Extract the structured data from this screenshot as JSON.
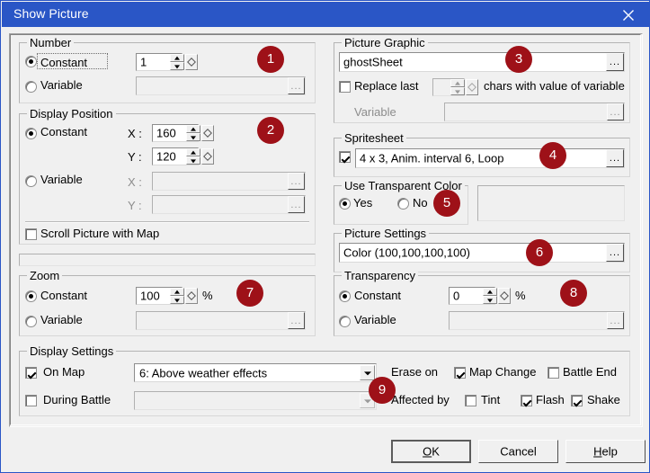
{
  "window": {
    "title": "Show Picture",
    "close_icon": "close-icon",
    "titlebar_color": "#2a56c6",
    "badge_color": "#9e1118",
    "background_color": "#f0f0f0"
  },
  "number_group": {
    "legend": "Number",
    "constant_label": "Constant",
    "constant_selected": true,
    "constant_value": "1",
    "variable_label": "Variable",
    "variable_selected": false,
    "variable_value": "",
    "browse_label": "...",
    "badge": "1"
  },
  "display_position_group": {
    "legend": "Display Position",
    "constant_label": "Constant",
    "constant_selected": true,
    "x_label": "X :",
    "x_value": "160",
    "y_label": "Y :",
    "y_value": "120",
    "variable_label": "Variable",
    "variable_selected": false,
    "var_x_label": "X :",
    "var_x_value": "",
    "var_y_label": "Y :",
    "var_y_value": "",
    "scroll_label": "Scroll Picture with Map",
    "scroll_checked": false,
    "browse_label": "...",
    "badge": "2"
  },
  "zoom_group": {
    "legend": "Zoom",
    "constant_label": "Constant",
    "constant_selected": true,
    "constant_value": "100",
    "percent": "%",
    "variable_label": "Variable",
    "variable_selected": false,
    "variable_value": "",
    "browse_label": "...",
    "badge": "7"
  },
  "picture_graphic_group": {
    "legend": "Picture Graphic",
    "graphic_value": "ghostSheet",
    "browse_label": "...",
    "replace_label": "Replace last",
    "replace_checked": false,
    "replace_count": "",
    "replace_suffix": "chars with value of variable",
    "variable_label": "Variable",
    "variable_value": "",
    "badge": "3"
  },
  "spritesheet_group": {
    "legend": "Spritesheet",
    "enabled": true,
    "value": "4 x 3, Anim. interval 6, Loop",
    "browse_label": "...",
    "badge": "4"
  },
  "transparent_color_group": {
    "legend": "Use Transparent Color",
    "yes_label": "Yes",
    "yes_selected": true,
    "no_label": "No",
    "no_selected": false,
    "side_panel_value": "",
    "badge": "5"
  },
  "picture_settings_group": {
    "legend": "Picture Settings",
    "value": "Color (100,100,100,100)",
    "browse_label": "...",
    "badge": "6"
  },
  "transparency_group": {
    "legend": "Transparency",
    "constant_label": "Constant",
    "constant_selected": true,
    "constant_value": "0",
    "percent": "%",
    "variable_label": "Variable",
    "variable_selected": false,
    "variable_value": "",
    "browse_label": "...",
    "badge": "8"
  },
  "display_settings_group": {
    "legend": "Display Settings",
    "on_map_label": "On Map",
    "on_map_checked": true,
    "on_map_value": "6: Above weather effects",
    "during_battle_label": "During Battle",
    "during_battle_checked": false,
    "during_battle_value": "",
    "erase_on_label": "Erase on",
    "map_change_label": "Map Change",
    "map_change_checked": true,
    "battle_end_label": "Battle End",
    "battle_end_checked": false,
    "affected_by_label": "Affected by",
    "tint_label": "Tint",
    "tint_checked": false,
    "flash_label": "Flash",
    "flash_checked": true,
    "shake_label": "Shake",
    "shake_checked": true,
    "badge": "9"
  },
  "buttons": {
    "ok": "OK",
    "ok_accel": "O",
    "ok_rest": "K",
    "cancel": "Cancel",
    "help": "Help",
    "help_accel": "H",
    "help_rest": "elp"
  }
}
